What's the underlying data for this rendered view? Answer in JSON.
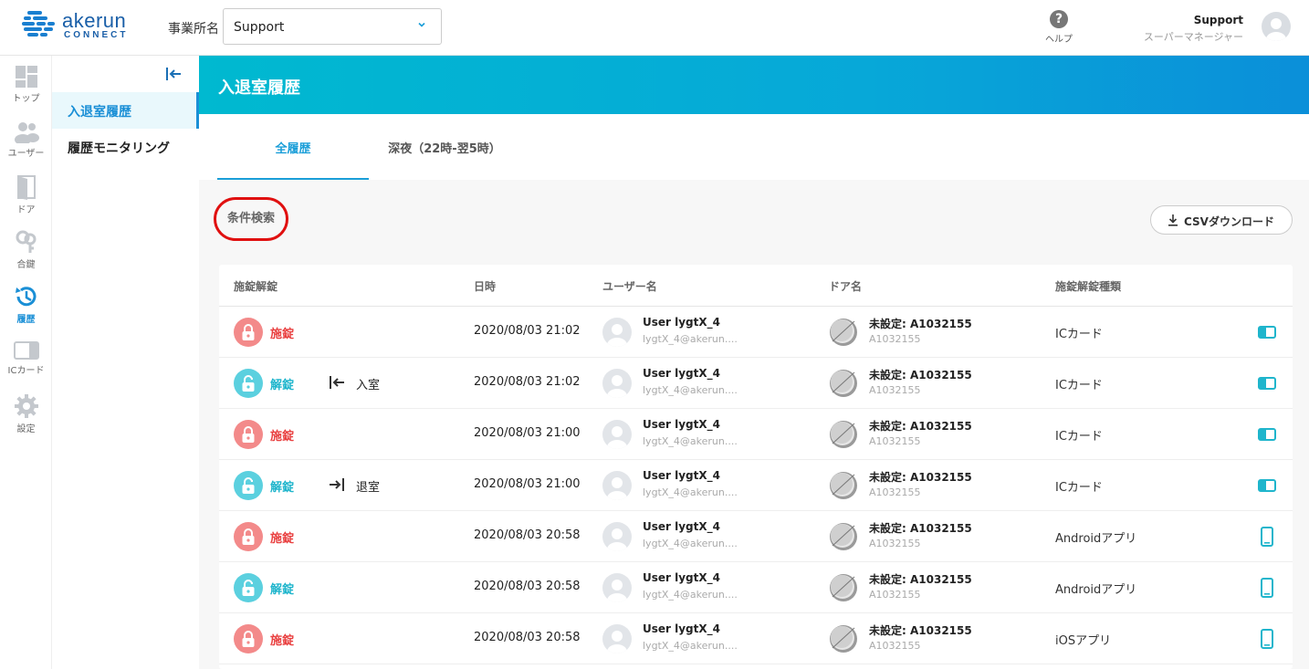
{
  "header": {
    "logo_text": "akerun",
    "logo_sub": "CONNECT",
    "office_label": "事業所名",
    "office_value": "Support",
    "help_label": "ヘルプ",
    "user_name": "Support",
    "user_role": "スーパーマネージャー"
  },
  "rail": [
    {
      "label": "トップ",
      "icon": "dashboard-icon"
    },
    {
      "label": "ユーザー",
      "icon": "users-icon"
    },
    {
      "label": "ドア",
      "icon": "door-icon"
    },
    {
      "label": "合鍵",
      "icon": "key-icon"
    },
    {
      "label": "履歴",
      "icon": "history-icon"
    },
    {
      "label": "ICカード",
      "icon": "card-icon"
    },
    {
      "label": "設定",
      "icon": "gear-icon"
    }
  ],
  "subnav": {
    "items": [
      "入退室履歴",
      "履歴モニタリング"
    ]
  },
  "page_title": "入退室履歴",
  "tabs": [
    "全履歴",
    "深夜（22時-翌5時）"
  ],
  "filter_label": "条件検索",
  "csv_label": "CSVダウンロード",
  "table": {
    "headers": [
      "施錠解錠",
      "日時",
      "ユーザー名",
      "ドア名",
      "施錠解錠種類"
    ],
    "rows": [
      {
        "status": "施錠",
        "type": "locked",
        "direction": "",
        "dir_icon": "",
        "datetime": "2020/08/03 21:02",
        "user": "User lygtX_4",
        "email": "lygtX_4@akerun....",
        "door": "未設定: A1032155",
        "door_id": "A1032155",
        "method": "ICカード",
        "method_icon": "card"
      },
      {
        "status": "解錠",
        "type": "unlocked",
        "direction": "入室",
        "dir_icon": "enter",
        "datetime": "2020/08/03 21:02",
        "user": "User lygtX_4",
        "email": "lygtX_4@akerun....",
        "door": "未設定: A1032155",
        "door_id": "A1032155",
        "method": "ICカード",
        "method_icon": "card"
      },
      {
        "status": "施錠",
        "type": "locked",
        "direction": "",
        "dir_icon": "",
        "datetime": "2020/08/03 21:00",
        "user": "User lygtX_4",
        "email": "lygtX_4@akerun....",
        "door": "未設定: A1032155",
        "door_id": "A1032155",
        "method": "ICカード",
        "method_icon": "card"
      },
      {
        "status": "解錠",
        "type": "unlocked",
        "direction": "退室",
        "dir_icon": "exit",
        "datetime": "2020/08/03 21:00",
        "user": "User lygtX_4",
        "email": "lygtX_4@akerun....",
        "door": "未設定: A1032155",
        "door_id": "A1032155",
        "method": "ICカード",
        "method_icon": "card"
      },
      {
        "status": "施錠",
        "type": "locked",
        "direction": "",
        "dir_icon": "",
        "datetime": "2020/08/03 20:58",
        "user": "User lygtX_4",
        "email": "lygtX_4@akerun....",
        "door": "未設定: A1032155",
        "door_id": "A1032155",
        "method": "Androidアプリ",
        "method_icon": "phone"
      },
      {
        "status": "解錠",
        "type": "unlocked",
        "direction": "",
        "dir_icon": "",
        "datetime": "2020/08/03 20:58",
        "user": "User lygtX_4",
        "email": "lygtX_4@akerun....",
        "door": "未設定: A1032155",
        "door_id": "A1032155",
        "method": "Androidアプリ",
        "method_icon": "phone"
      },
      {
        "status": "施錠",
        "type": "locked",
        "direction": "",
        "dir_icon": "",
        "datetime": "2020/08/03 20:58",
        "user": "User lygtX_4",
        "email": "lygtX_4@akerun....",
        "door": "未設定: A1032155",
        "door_id": "A1032155",
        "method": "iOSアプリ",
        "method_icon": "phone"
      }
    ]
  },
  "colors": {
    "accent": "#1a9ed8",
    "locked": "#e94040",
    "unlocked": "#1fb5cc",
    "highlight_ring": "#e01010"
  }
}
